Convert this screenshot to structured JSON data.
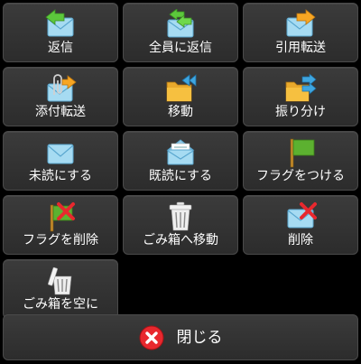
{
  "menu": {
    "items": [
      {
        "label": "返信",
        "icon": "envelope-reply-icon"
      },
      {
        "label": "全員に返信",
        "icon": "envelope-reply-all-icon"
      },
      {
        "label": "引用転送",
        "icon": "envelope-forward-icon"
      },
      {
        "label": "添付転送",
        "icon": "envelope-attach-forward-icon"
      },
      {
        "label": "移動",
        "icon": "folder-move-icon"
      },
      {
        "label": "振り分け",
        "icon": "folder-sort-icon"
      },
      {
        "label": "未読にする",
        "icon": "envelope-closed-icon"
      },
      {
        "label": "既読にする",
        "icon": "envelope-open-icon"
      },
      {
        "label": "フラグをつける",
        "icon": "flag-icon"
      },
      {
        "label": "フラグを削除",
        "icon": "flag-remove-icon"
      },
      {
        "label": "ごみ箱へ移動",
        "icon": "trash-icon"
      },
      {
        "label": "削除",
        "icon": "envelope-delete-icon"
      },
      {
        "label": "ごみ箱を空に",
        "icon": "empty-trash-icon"
      }
    ]
  },
  "close": {
    "label": "閉じる",
    "icon": "close-circle-icon"
  },
  "colors": {
    "button_bg": "#333333",
    "button_border": "#4a4a4a",
    "text": "#ffffff",
    "envelope": "#9fd4ee",
    "arrow_green": "#5cc83c",
    "arrow_orange": "#f7a623",
    "folder": "#f6c040",
    "flag_green": "#5cb130",
    "delete_red": "#e8282e"
  }
}
